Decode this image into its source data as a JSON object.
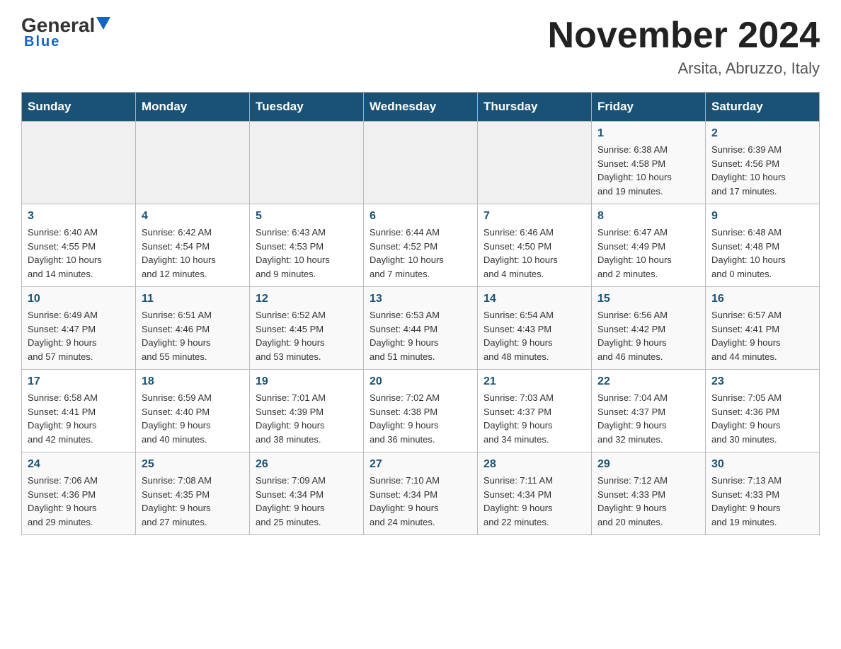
{
  "header": {
    "logo_general": "General",
    "logo_blue": "Blue",
    "month_title": "November 2024",
    "location": "Arsita, Abruzzo, Italy"
  },
  "weekdays": [
    "Sunday",
    "Monday",
    "Tuesday",
    "Wednesday",
    "Thursday",
    "Friday",
    "Saturday"
  ],
  "weeks": [
    [
      {
        "day": "",
        "info": ""
      },
      {
        "day": "",
        "info": ""
      },
      {
        "day": "",
        "info": ""
      },
      {
        "day": "",
        "info": ""
      },
      {
        "day": "",
        "info": ""
      },
      {
        "day": "1",
        "info": "Sunrise: 6:38 AM\nSunset: 4:58 PM\nDaylight: 10 hours\nand 19 minutes."
      },
      {
        "day": "2",
        "info": "Sunrise: 6:39 AM\nSunset: 4:56 PM\nDaylight: 10 hours\nand 17 minutes."
      }
    ],
    [
      {
        "day": "3",
        "info": "Sunrise: 6:40 AM\nSunset: 4:55 PM\nDaylight: 10 hours\nand 14 minutes."
      },
      {
        "day": "4",
        "info": "Sunrise: 6:42 AM\nSunset: 4:54 PM\nDaylight: 10 hours\nand 12 minutes."
      },
      {
        "day": "5",
        "info": "Sunrise: 6:43 AM\nSunset: 4:53 PM\nDaylight: 10 hours\nand 9 minutes."
      },
      {
        "day": "6",
        "info": "Sunrise: 6:44 AM\nSunset: 4:52 PM\nDaylight: 10 hours\nand 7 minutes."
      },
      {
        "day": "7",
        "info": "Sunrise: 6:46 AM\nSunset: 4:50 PM\nDaylight: 10 hours\nand 4 minutes."
      },
      {
        "day": "8",
        "info": "Sunrise: 6:47 AM\nSunset: 4:49 PM\nDaylight: 10 hours\nand 2 minutes."
      },
      {
        "day": "9",
        "info": "Sunrise: 6:48 AM\nSunset: 4:48 PM\nDaylight: 10 hours\nand 0 minutes."
      }
    ],
    [
      {
        "day": "10",
        "info": "Sunrise: 6:49 AM\nSunset: 4:47 PM\nDaylight: 9 hours\nand 57 minutes."
      },
      {
        "day": "11",
        "info": "Sunrise: 6:51 AM\nSunset: 4:46 PM\nDaylight: 9 hours\nand 55 minutes."
      },
      {
        "day": "12",
        "info": "Sunrise: 6:52 AM\nSunset: 4:45 PM\nDaylight: 9 hours\nand 53 minutes."
      },
      {
        "day": "13",
        "info": "Sunrise: 6:53 AM\nSunset: 4:44 PM\nDaylight: 9 hours\nand 51 minutes."
      },
      {
        "day": "14",
        "info": "Sunrise: 6:54 AM\nSunset: 4:43 PM\nDaylight: 9 hours\nand 48 minutes."
      },
      {
        "day": "15",
        "info": "Sunrise: 6:56 AM\nSunset: 4:42 PM\nDaylight: 9 hours\nand 46 minutes."
      },
      {
        "day": "16",
        "info": "Sunrise: 6:57 AM\nSunset: 4:41 PM\nDaylight: 9 hours\nand 44 minutes."
      }
    ],
    [
      {
        "day": "17",
        "info": "Sunrise: 6:58 AM\nSunset: 4:41 PM\nDaylight: 9 hours\nand 42 minutes."
      },
      {
        "day": "18",
        "info": "Sunrise: 6:59 AM\nSunset: 4:40 PM\nDaylight: 9 hours\nand 40 minutes."
      },
      {
        "day": "19",
        "info": "Sunrise: 7:01 AM\nSunset: 4:39 PM\nDaylight: 9 hours\nand 38 minutes."
      },
      {
        "day": "20",
        "info": "Sunrise: 7:02 AM\nSunset: 4:38 PM\nDaylight: 9 hours\nand 36 minutes."
      },
      {
        "day": "21",
        "info": "Sunrise: 7:03 AM\nSunset: 4:37 PM\nDaylight: 9 hours\nand 34 minutes."
      },
      {
        "day": "22",
        "info": "Sunrise: 7:04 AM\nSunset: 4:37 PM\nDaylight: 9 hours\nand 32 minutes."
      },
      {
        "day": "23",
        "info": "Sunrise: 7:05 AM\nSunset: 4:36 PM\nDaylight: 9 hours\nand 30 minutes."
      }
    ],
    [
      {
        "day": "24",
        "info": "Sunrise: 7:06 AM\nSunset: 4:36 PM\nDaylight: 9 hours\nand 29 minutes."
      },
      {
        "day": "25",
        "info": "Sunrise: 7:08 AM\nSunset: 4:35 PM\nDaylight: 9 hours\nand 27 minutes."
      },
      {
        "day": "26",
        "info": "Sunrise: 7:09 AM\nSunset: 4:34 PM\nDaylight: 9 hours\nand 25 minutes."
      },
      {
        "day": "27",
        "info": "Sunrise: 7:10 AM\nSunset: 4:34 PM\nDaylight: 9 hours\nand 24 minutes."
      },
      {
        "day": "28",
        "info": "Sunrise: 7:11 AM\nSunset: 4:34 PM\nDaylight: 9 hours\nand 22 minutes."
      },
      {
        "day": "29",
        "info": "Sunrise: 7:12 AM\nSunset: 4:33 PM\nDaylight: 9 hours\nand 20 minutes."
      },
      {
        "day": "30",
        "info": "Sunrise: 7:13 AM\nSunset: 4:33 PM\nDaylight: 9 hours\nand 19 minutes."
      }
    ]
  ]
}
